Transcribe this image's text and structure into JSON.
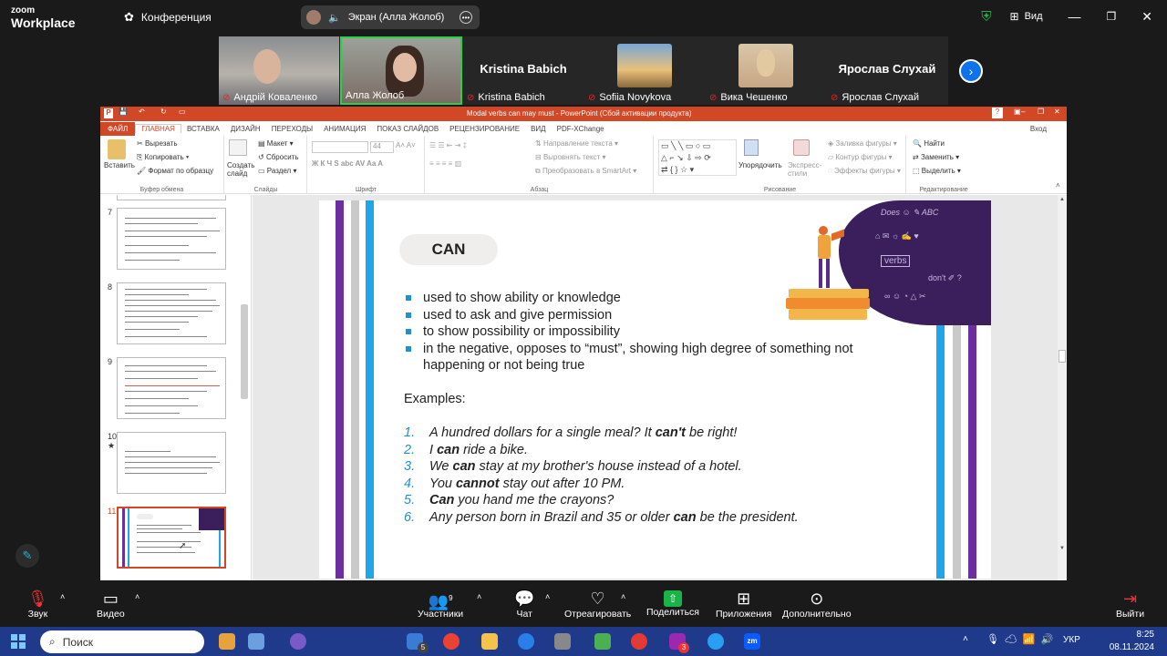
{
  "zoom": {
    "brand_line1": "zoom",
    "brand_line2": "Workplace",
    "conference": "Конференция",
    "share_status": "Экран (Алла Жолоб)",
    "view": "Вид",
    "participants": [
      {
        "name": "Андрій Коваленко",
        "muted": true
      },
      {
        "name": "Алла Жолоб",
        "muted": false,
        "active": true
      },
      {
        "name": "Kristina Babich",
        "big": "Kristina Babich",
        "muted": true
      },
      {
        "name": "Sofiia Novykova",
        "muted": true
      },
      {
        "name": "Вика Чешенко",
        "muted": true
      },
      {
        "name": "Ярослав Слухай",
        "big": "Ярослав Слухай",
        "muted": true
      }
    ],
    "toolbar": {
      "audio": "Звук",
      "video": "Видео",
      "participants": "Участники",
      "participants_count": "9",
      "chat": "Чат",
      "react": "Отреагировать",
      "share": "Поделиться",
      "apps": "Приложения",
      "more": "Дополнительно",
      "leave": "Выйти"
    }
  },
  "ppt": {
    "title": "Modal verbs can may must  -  PowerPoint (Сбой активации продукта)",
    "signin": "Вход",
    "tabs": [
      "ФАЙЛ",
      "ГЛАВНАЯ",
      "ВСТАВКА",
      "ДИЗАЙН",
      "ПЕРЕХОДЫ",
      "АНИМАЦИЯ",
      "ПОКАЗ СЛАЙДОВ",
      "РЕЦЕНЗИРОВАНИЕ",
      "ВИД",
      "PDF-XChange"
    ],
    "ribbon": {
      "paste": "Вставить",
      "cut": "Вырезать",
      "copy": "Копировать",
      "format_painter": "Формат по образцу",
      "clipboard": "Буфер обмена",
      "new_slide": "Создать слайд",
      "layout": "Макет",
      "reset": "Сбросить",
      "section": "Раздел",
      "slides": "Слайды",
      "font_size": "44",
      "font": "Шрифт",
      "text_direction": "Направление текста",
      "align_text": "Выровнять текст",
      "smartart": "Преобразовать в SmartArt",
      "paragraph": "Абзац",
      "arrange": "Упорядочить",
      "quick_styles": "Экспресс-стили",
      "shape_fill": "Заливка фигуры",
      "shape_outline": "Контур фигуры",
      "shape_effects": "Эффекты фигуры",
      "drawing": "Рисование",
      "find": "Найти",
      "replace": "Заменить",
      "select": "Выделить",
      "editing": "Редактирование"
    },
    "thumb_numbers": [
      "7",
      "8",
      "9",
      "10",
      "11"
    ],
    "slide": {
      "heading": "CAN",
      "bullets": [
        "used to show ability or knowledge",
        "used to ask and give permission",
        "to show possibility or impossibility",
        "in the negative, opposes to “must”, showing high degree of something not happening or not being true"
      ],
      "examples_title": "Examples:",
      "examples": [
        {
          "num": "1.",
          "pre": "A hundred dollars for a single meal? It ",
          "bold": "can't",
          "post": " be right!"
        },
        {
          "num": "2.",
          "pre": "I ",
          "bold": "can",
          "post": " ride a bike."
        },
        {
          "num": "3.",
          "pre": "We ",
          "bold": "can",
          "post": " stay at my brother's house instead of a hotel."
        },
        {
          "num": "4.",
          "pre": "You ",
          "bold": "cannot",
          "post": " stay out after 10 PM."
        },
        {
          "num": "5.",
          "pre": "",
          "bold": "Can",
          "post": " you hand me the crayons?"
        },
        {
          "num": "6.",
          "pre": "Any person born in Brazil and 35 or older ",
          "bold": "can",
          "post": " be the president."
        }
      ]
    }
  },
  "taskbar": {
    "search": "Поиск",
    "lang": "УКР",
    "time": "8:25",
    "date": "08.11.2024",
    "badge_mail": "5",
    "badge_a": "3"
  }
}
